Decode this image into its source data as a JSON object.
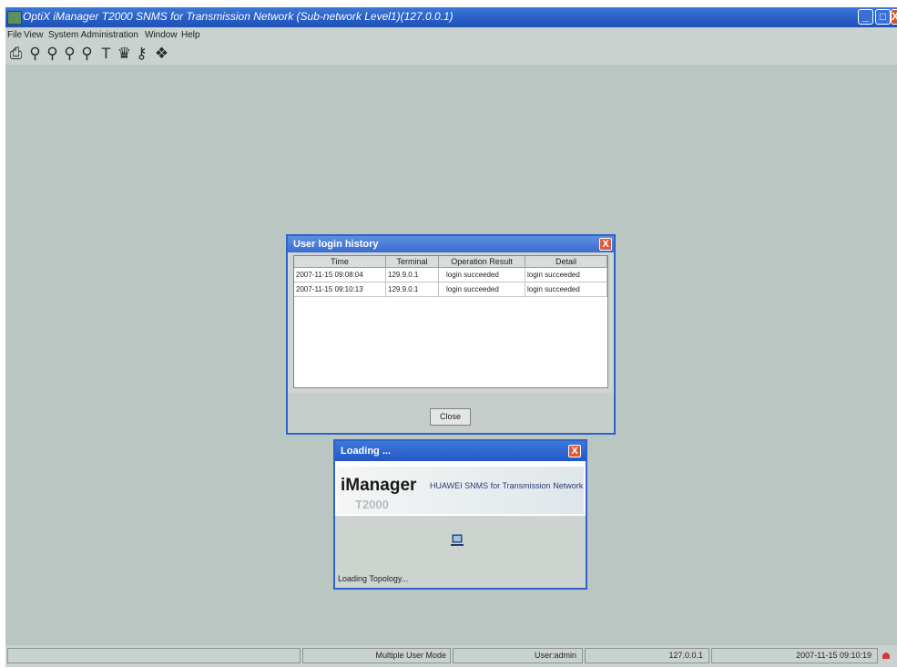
{
  "window": {
    "title": "OptiX iManager T2000 SNMS for Transmission Network (Sub-network Level1)(127.0.0.1)",
    "controls": {
      "minimize": "_",
      "maximize": "□",
      "close": "X"
    }
  },
  "menu": [
    "File",
    "View",
    "System Administration",
    "Window",
    "Help"
  ],
  "toolbar": [
    "printer-icon",
    "zoom-in-icon",
    "zoom-out-icon",
    "zoom-fit-icon",
    "zoom-reset-icon",
    "text-tool-icon",
    "find-icon",
    "topology-link-icon",
    "layers-icon"
  ],
  "login_dialog": {
    "title": "User login history",
    "close": "X",
    "columns": [
      "Time",
      "Terminal",
      "Operation Result",
      "Detail"
    ],
    "rows": [
      [
        "2007-11-15 09:08:04",
        "129.9.0.1",
        "login succeeded",
        "login succeeded"
      ],
      [
        "2007-11-15 09:10:13",
        "129.9.0.1",
        "login succeeded",
        "login succeeded"
      ]
    ],
    "close_button": "Close"
  },
  "loading_dialog": {
    "title": "Loading ...",
    "close": "X",
    "brand": "iManager",
    "brand_sub": "T2000",
    "brand_desc": "HUAWEI SNMS for Transmission Network",
    "status": "Loading Topology..."
  },
  "statusbar": {
    "mode": "Multiple User Mode",
    "user": "User:admin",
    "ip": "127.0.0.1",
    "datetime": "2007-11-15 09:10:19"
  },
  "colors": {
    "titlebar": "#2a60c8",
    "desktop": "#b9c6c1",
    "close_red": "#dd5a38"
  }
}
